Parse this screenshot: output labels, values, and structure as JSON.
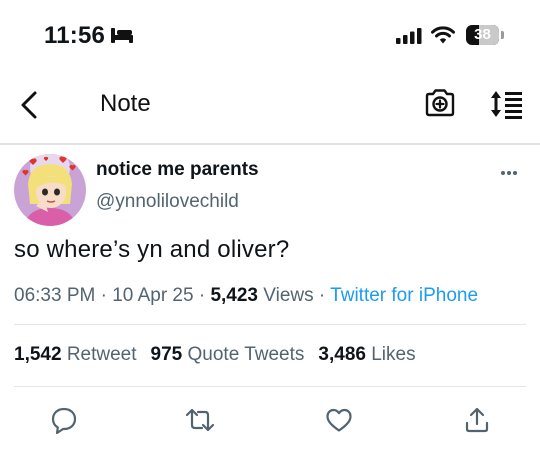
{
  "status_bar": {
    "time": "11:56",
    "battery": "38",
    "battery_level": 0.38,
    "icons": [
      "bed-icon",
      "signal-icon",
      "wifi-icon",
      "battery-icon"
    ]
  },
  "nav": {
    "title": "Note",
    "icons": [
      "chevron-left-icon",
      "camera-icon",
      "reorder-icon"
    ]
  },
  "tweet": {
    "display_name": "notice me parents",
    "handle": "@ynnolilovechild",
    "text": "so where’s yn and oliver?",
    "time": "06:33 PM",
    "date": "10 Apr 25",
    "views_count": "5,423",
    "views_label": "Views",
    "source": "Twitter for iPhone",
    "separator": "·"
  },
  "stats": {
    "retweets_count": "1,542",
    "retweets_label": "Retweet",
    "quotes_count": "975",
    "quotes_label": "Quote Tweets",
    "likes_count": "3,486",
    "likes_label": "Likes"
  },
  "actions": [
    "reply-icon",
    "retweet-icon",
    "like-icon",
    "share-icon"
  ],
  "colors": {
    "text": "#0f1419",
    "secondary": "#536471",
    "link": "#1d9bf0",
    "divider": "#e6e6e6"
  }
}
